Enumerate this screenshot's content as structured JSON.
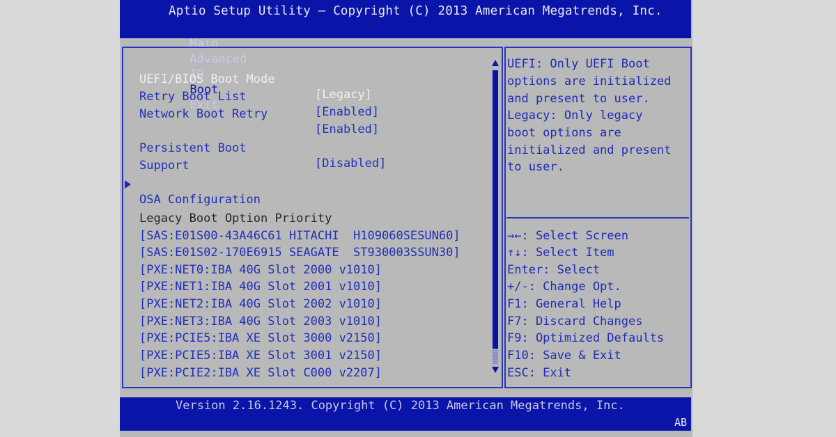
{
  "header": {
    "title": "Aptio Setup Utility – Copyright (C) 2013 American Megatrends, Inc.",
    "tabs": [
      "Main",
      "Advanced",
      "IO",
      "Boot",
      "Exit"
    ],
    "active_tab": "Boot"
  },
  "settings": [
    {
      "label": "UEFI/BIOS Boot Mode",
      "value": "[Legacy]"
    },
    {
      "label": "Retry Boot List",
      "value": "[Enabled]"
    },
    {
      "label": "Network Boot Retry",
      "value": "[Enabled]"
    },
    {
      "label": "Persistent Boot",
      "label2": "Support",
      "value": "[Disabled]"
    }
  ],
  "submenu": {
    "label": "OSA Configuration",
    "icon": "submenu-arrow-icon"
  },
  "legacy": {
    "heading": "Legacy Boot Option Priority",
    "items": [
      "[SAS:E01S00-43A46C61 HITACHI  H109060SESUN60]",
      "[SAS:E01S02-170E6915 SEAGATE  ST930003SSUN30]",
      "[PXE:NET0:IBA 40G Slot 2000 v1010]",
      "[PXE:NET1:IBA 40G Slot 2001 v1010]",
      "[PXE:NET2:IBA 40G Slot 2002 v1010]",
      "[PXE:NET3:IBA 40G Slot 2003 v1010]",
      "[PXE:PCIE5:IBA XE Slot 3000 v2150]",
      "[PXE:PCIE5:IBA XE Slot 3001 v2150]",
      "[PXE:PCIE2:IBA XE Slot C000 v2207]"
    ]
  },
  "help": {
    "description": [
      "UEFI: Only UEFI Boot",
      "options are initialized",
      "and present to user.",
      "Legacy: Only legacy",
      "boot options are",
      "initialized and present",
      "to user."
    ],
    "keys": [
      "→←: Select Screen",
      "↑↓: Select Item",
      "Enter: Select",
      "+/-: Change Opt.",
      "F1: General Help",
      "F7: Discard Changes",
      "F9: Optimized Defaults",
      "F10: Save & Exit",
      "ESC: Exit"
    ]
  },
  "footer": {
    "version": "Version 2.16.1243. Copyright (C) 2013 American Megatrends, Inc.",
    "badge": "AB"
  },
  "colors": {
    "header_blue": "#0b14a8",
    "body_gray": "#b9b9b9",
    "text_blue": "#2030b8",
    "selected_white": "#f0f0f4"
  }
}
